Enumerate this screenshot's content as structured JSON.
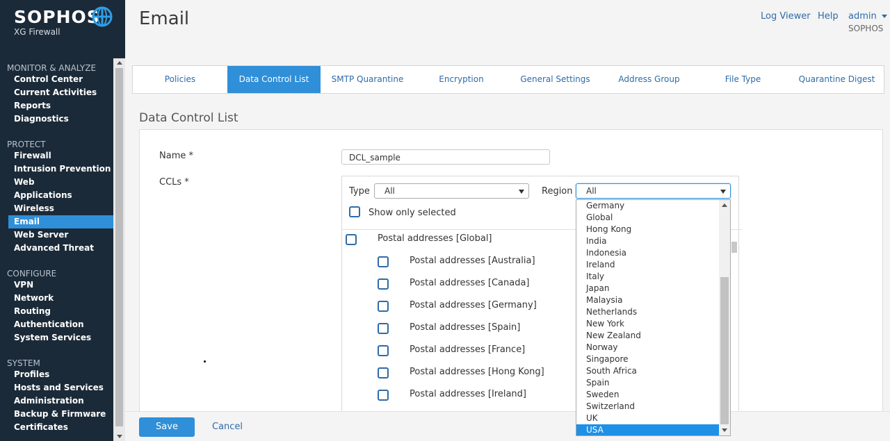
{
  "brand": {
    "name": "SOPHOS",
    "product": "XG Firewall"
  },
  "sidebar": {
    "sections": [
      {
        "title": "MONITOR & ANALYZE",
        "items": [
          "Control Center",
          "Current Activities",
          "Reports",
          "Diagnostics"
        ]
      },
      {
        "title": "PROTECT",
        "items": [
          "Firewall",
          "Intrusion Prevention",
          "Web",
          "Applications",
          "Wireless",
          "Email",
          "Web Server",
          "Advanced Threat"
        ]
      },
      {
        "title": "CONFIGURE",
        "items": [
          "VPN",
          "Network",
          "Routing",
          "Authentication",
          "System Services"
        ]
      },
      {
        "title": "SYSTEM",
        "items": [
          "Profiles",
          "Hosts and Services",
          "Administration",
          "Backup & Firmware",
          "Certificates"
        ]
      }
    ],
    "active_item": "Email"
  },
  "header": {
    "title": "Email",
    "links": {
      "log_viewer": "Log Viewer",
      "help": "Help",
      "admin": "admin"
    },
    "org": "SOPHOS"
  },
  "tabs": [
    "Policies",
    "Data Control List",
    "SMTP Quarantine",
    "Encryption",
    "General Settings",
    "Address Group",
    "File Type",
    "Quarantine Digest"
  ],
  "active_tab": "Data Control List",
  "section_title": "Data Control List",
  "form": {
    "name_label": "Name *",
    "name_value": "DCL_sample",
    "ccls_label": "CCLs *",
    "type_label": "Type",
    "type_value": "All",
    "region_label": "Region",
    "region_value": "All",
    "show_only_selected": "Show only selected"
  },
  "ccl_list": {
    "group": "Postal addresses [Global]",
    "items": [
      "Postal addresses [Australia]",
      "Postal addresses [Canada]",
      "Postal addresses [Germany]",
      "Postal addresses [Spain]",
      "Postal addresses [France]",
      "Postal addresses [Hong Kong]",
      "Postal addresses [Ireland]"
    ]
  },
  "region_dropdown": {
    "options": [
      "Germany",
      "Global",
      "Hong Kong",
      "India",
      "Indonesia",
      "Ireland",
      "Italy",
      "Japan",
      "Malaysia",
      "Netherlands",
      "New York",
      "New Zealand",
      "Norway",
      "Singapore",
      "South Africa",
      "Spain",
      "Sweden",
      "Switzerland",
      "UK",
      "USA"
    ],
    "highlighted": "USA"
  },
  "footer": {
    "save": "Save",
    "cancel": "Cancel"
  },
  "colors": {
    "sidebar_bg": "#1b2a38",
    "accent": "#2f8fd8",
    "link": "#2f6aa8"
  }
}
